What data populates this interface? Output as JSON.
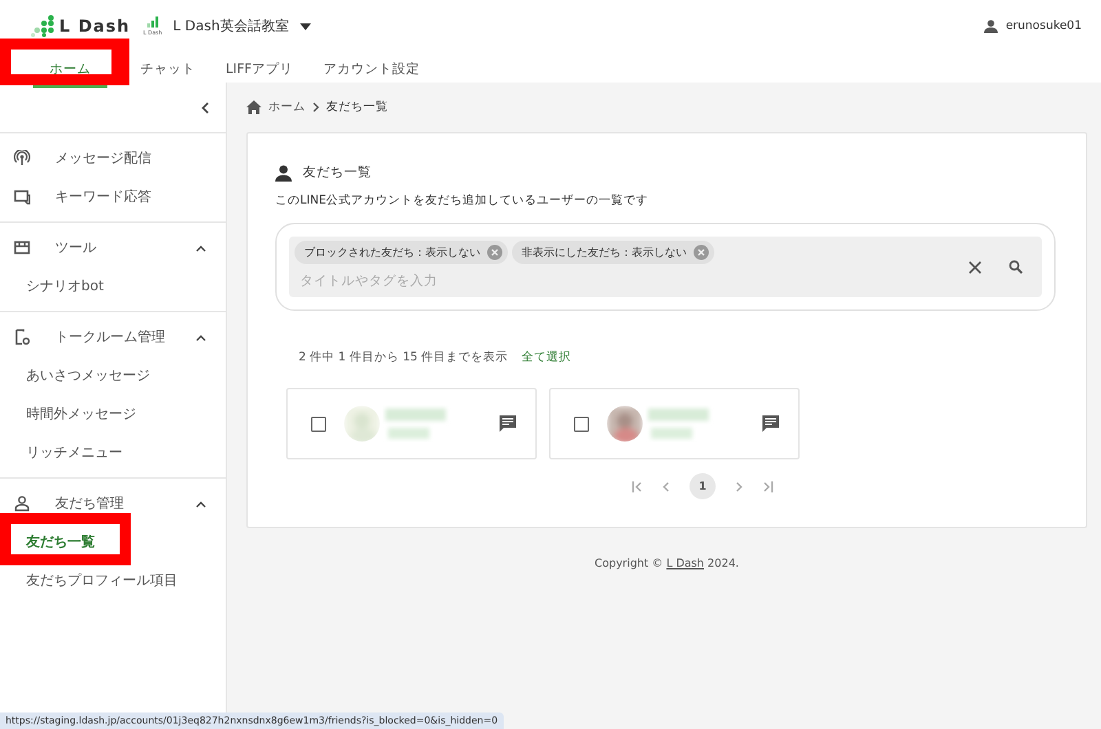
{
  "header": {
    "logo": "L Dash",
    "account_logo": "L Dash",
    "account": "L Dash英会話教室",
    "user": "erunosuke01"
  },
  "tabs": [
    {
      "label": "ホーム",
      "selected": true,
      "highlighted": true
    },
    {
      "label": "チャット",
      "selected": false,
      "highlighted": false
    },
    {
      "label": "LIFFアプリ",
      "selected": false,
      "highlighted": false
    },
    {
      "label": "アカウント設定",
      "selected": false,
      "highlighted": false
    }
  ],
  "sidebar": {
    "sections": [
      {
        "kind": "links",
        "items": [
          {
            "label": "メッセージ配信"
          },
          {
            "label": "キーワード応答"
          }
        ]
      },
      {
        "kind": "group",
        "label": "ツール",
        "expanded": true,
        "children": [
          {
            "label": "シナリオbot",
            "selected": false,
            "highlighted": false
          }
        ]
      },
      {
        "kind": "group",
        "label": "トークルーム管理",
        "expanded": true,
        "children": [
          {
            "label": "あいさつメッセージ",
            "selected": false,
            "highlighted": false
          },
          {
            "label": "時間外メッセージ",
            "selected": false,
            "highlighted": false
          },
          {
            "label": "リッチメニュー",
            "selected": false,
            "highlighted": false
          }
        ]
      },
      {
        "kind": "group",
        "label": "友だち管理",
        "expanded": true,
        "children": [
          {
            "label": "友だち一覧",
            "selected": true,
            "highlighted": true
          },
          {
            "label": "友だちプロフィール項目",
            "selected": false,
            "highlighted": false
          }
        ]
      }
    ]
  },
  "breadcrumb": [
    "ホーム",
    "友だち一覧"
  ],
  "card": {
    "title": "友だち一覧",
    "description": "このLINE公式アカウントを友だち追加しているユーザーの一覧です",
    "filters": [
      "ブロックされた友だち：表示しない",
      "非表示にした友だち：表示しない"
    ],
    "search": {
      "placeholder": "タイトルやタグを入力"
    },
    "count": "2 件中 1 件目から 15 件目までを表示",
    "select_all": "全て選択",
    "friends": [
      {
        "checked": false
      },
      {
        "checked": false
      }
    ],
    "pagination": {
      "current": "1"
    }
  },
  "footer": {
    "before": "Copyright © ",
    "link": "L Dash",
    "after": " 2024."
  },
  "status_url": "https://staging.ldash.jp/accounts/01j3eq827h2nxnsdnx8g6ew1m3/friends?is_blocked=0&is_hidden=0"
}
